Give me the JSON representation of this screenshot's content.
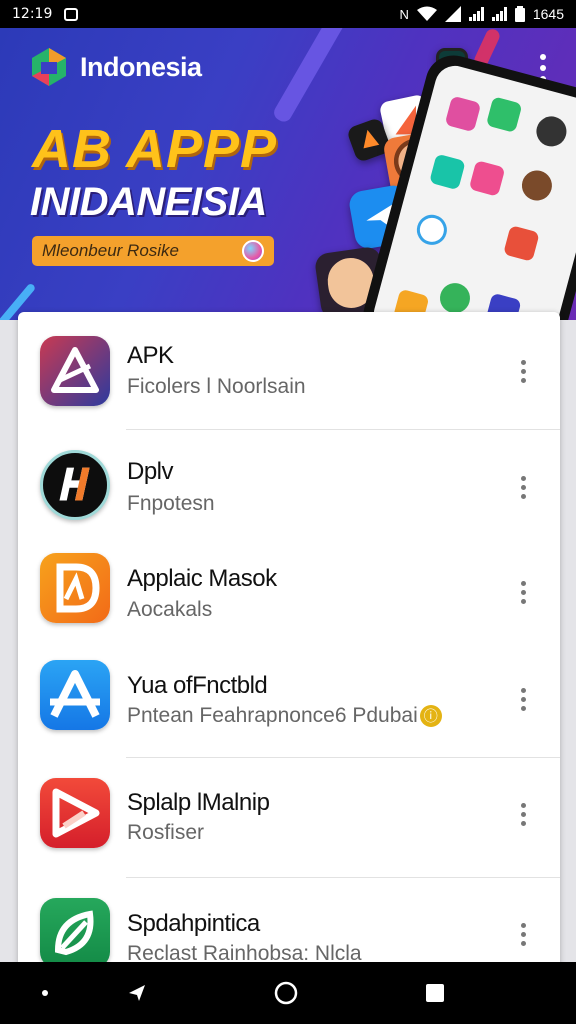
{
  "status_bar": {
    "time": "12:19",
    "battery_text": "1645",
    "icons": [
      "notification-icon",
      "nfc-icon",
      "wifi-icon",
      "signal-icon",
      "battery-icon"
    ]
  },
  "banner": {
    "brand_name": "Indonesia",
    "headline_1": "AB APPP",
    "headline_2": "INIDANEISIA",
    "pill_text": "Mleonbeur Rosike",
    "colors": {
      "background_start": "#2c3ab8",
      "background_end": "#6a2bb5",
      "headline_accent": "#ffc21a",
      "pill": "#f4a12c"
    }
  },
  "app_list": [
    {
      "title": "APK",
      "subtitle": "Ficolers l Noorlsain",
      "icon": "apk-triangle-icon",
      "colors": [
        "#2d3a9e",
        "#c93a52"
      ]
    },
    {
      "title": "Dplv",
      "subtitle": "Fnpotesn",
      "icon": "dplv-h-icon",
      "colors": [
        "#0d0d0d",
        "#f07a2a"
      ]
    },
    {
      "title": "Applaic Masok",
      "subtitle": "Aocakals",
      "icon": "d-letter-icon",
      "colors": [
        "#f7961c",
        "#f26a18"
      ]
    },
    {
      "title": "Yua ofFnctbld",
      "subtitle": "Pntean Feahrapnonce6 Pdubai",
      "icon": "a-letter-icon",
      "colors": [
        "#2b9cf2",
        "#1577e6"
      ],
      "badge": "ⓘ"
    },
    {
      "title": "Splalp lMalnip",
      "subtitle": "Rosfiser",
      "icon": "play-arrow-icon",
      "colors": [
        "#f03b36",
        "#d51f2b"
      ]
    },
    {
      "title": "Spdahpintica",
      "subtitle": "Reclast Rainhobsa: Nlcla",
      "icon": "leaf-icon",
      "colors": [
        "#1f9e55",
        "#138a46"
      ]
    }
  ],
  "nav_bar": {
    "buttons": [
      "back-icon",
      "home-icon",
      "recents-icon"
    ]
  }
}
